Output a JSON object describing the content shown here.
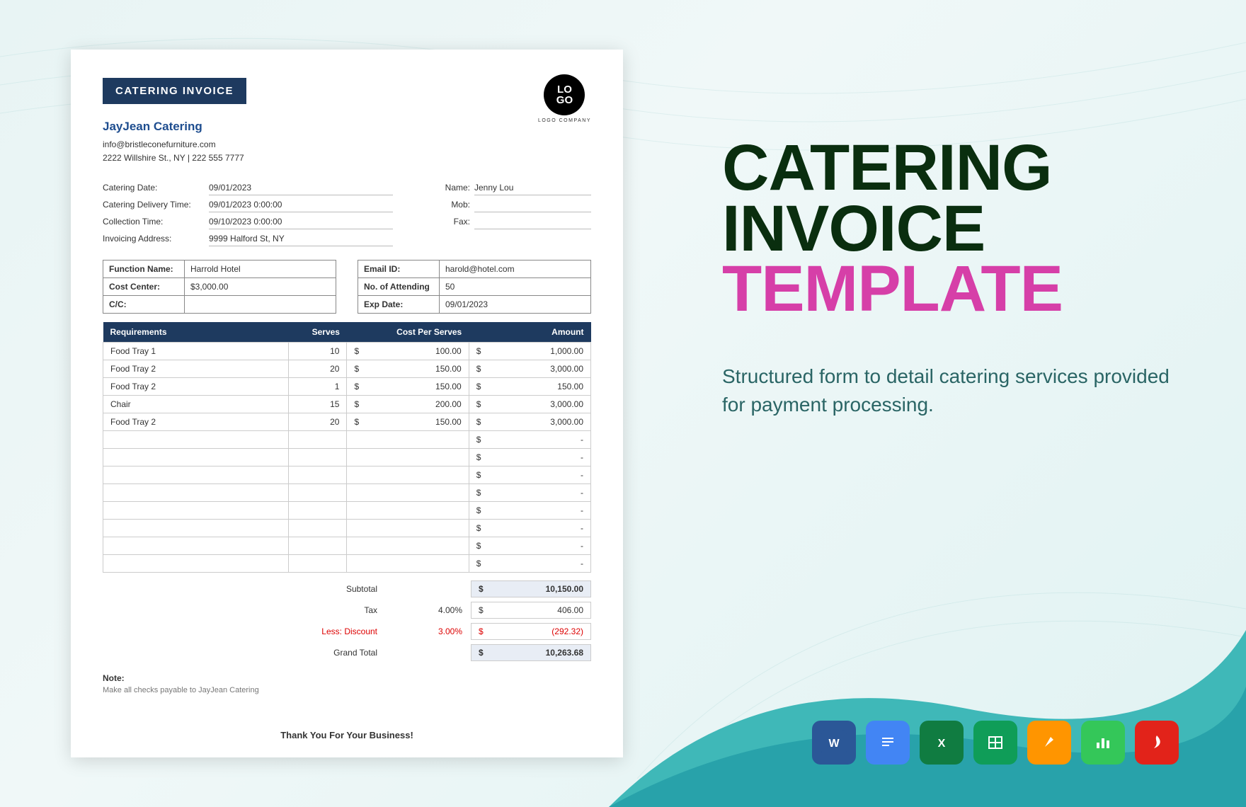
{
  "invoice": {
    "badge": "CATERING INVOICE",
    "logo_top": "LO",
    "logo_bot": "GO",
    "logo_sub": "LOGO COMPANY",
    "company": "JayJean Catering",
    "email": "info@bristleconefurniture.com",
    "address": "2222 Willshire St., NY | 222 555 7777",
    "left_fields": [
      {
        "label": "Catering Date:",
        "value": "09/01/2023"
      },
      {
        "label": "Catering Delivery Time:",
        "value": "09/01/2023 0:00:00"
      },
      {
        "label": "Collection Time:",
        "value": "09/10/2023 0:00:00"
      },
      {
        "label": "Invoicing Address:",
        "value": "9999 Halford St, NY"
      }
    ],
    "right_fields": [
      {
        "label": "Name:",
        "value": "Jenny Lou"
      },
      {
        "label": "Mob:",
        "value": ""
      },
      {
        "label": "Fax:",
        "value": ""
      }
    ],
    "box_left": [
      {
        "label": "Function Name:",
        "value": "Harrold Hotel"
      },
      {
        "label": "Cost Center:",
        "value": "$3,000.00"
      },
      {
        "label": "C/C:",
        "value": ""
      }
    ],
    "box_right": [
      {
        "label": "Email ID:",
        "value": "harold@hotel.com"
      },
      {
        "label": "No. of Attending",
        "value": "50"
      },
      {
        "label": "Exp Date:",
        "value": "09/01/2023"
      }
    ],
    "headers": {
      "req": "Requirements",
      "srv": "Serves",
      "cps": "Cost Per Serves",
      "amt": "Amount"
    },
    "items": [
      {
        "req": "Food Tray 1",
        "srv": "10",
        "cps": "100.00",
        "amt": "1,000.00"
      },
      {
        "req": "Food Tray 2",
        "srv": "20",
        "cps": "150.00",
        "amt": "3,000.00"
      },
      {
        "req": "Food Tray 2",
        "srv": "1",
        "cps": "150.00",
        "amt": "150.00"
      },
      {
        "req": "Chair",
        "srv": "15",
        "cps": "200.00",
        "amt": "3,000.00"
      },
      {
        "req": "Food Tray 2",
        "srv": "20",
        "cps": "150.00",
        "amt": "3,000.00"
      }
    ],
    "empty_rows": 8,
    "totals": {
      "subtotal_label": "Subtotal",
      "subtotal": "10,150.00",
      "tax_label": "Tax",
      "tax_pct": "4.00%",
      "tax": "406.00",
      "disc_label": "Less: Discount",
      "disc_pct": "3.00%",
      "disc": "(292.32)",
      "grand_label": "Grand Total",
      "grand": "10,263.68"
    },
    "note_label": "Note:",
    "note": "Make all checks payable to JayJean Catering",
    "thanks": "Thank You For Your Business!"
  },
  "promo": {
    "line1": "CATERING",
    "line2": "INVOICE",
    "line3": "TEMPLATE",
    "desc": "Structured form to detail catering services provided for payment processing."
  },
  "formats": [
    "word",
    "gdocs",
    "excel",
    "gsheets",
    "pages",
    "numbers",
    "pdf"
  ]
}
